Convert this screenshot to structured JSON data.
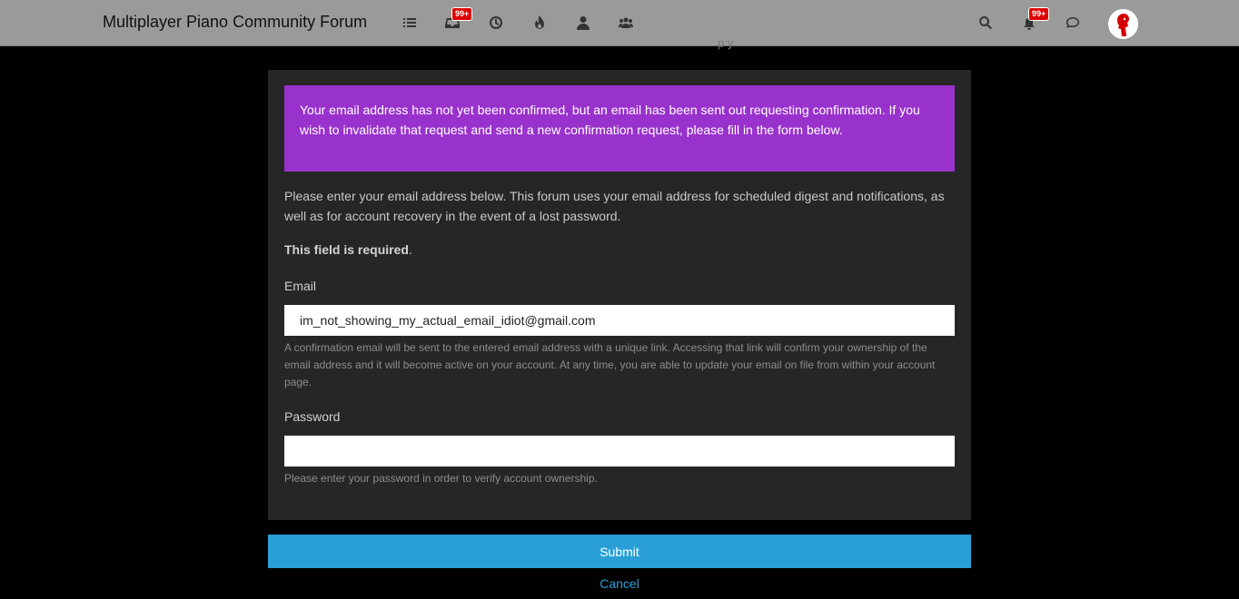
{
  "header": {
    "brand": "Multiplayer Piano Community Forum",
    "nav_icons": [
      "list-icon",
      "inbox-icon",
      "clock-icon",
      "fire-icon",
      "user-icon",
      "group-icon"
    ],
    "inbox_badge": "99+",
    "notifications_badge": "99+",
    "right_icons": [
      "search-icon",
      "bell-icon",
      "chat-icon"
    ]
  },
  "peek_text": "p    y",
  "alert": {
    "text": "Your email address has not yet been confirmed, but an email has been sent out requesting confirmation. If you wish to invalidate that request and send a new confirmation request, please fill in the form below.",
    "color": "#9932cc"
  },
  "intro": "Please enter your email address below. This forum uses your email address for scheduled digest and notifications, as well as for account recovery in the event of a lost password.",
  "required": {
    "bold": "This field is required",
    "suffix": "."
  },
  "email": {
    "label": "Email",
    "value": "im_not_showing_my_actual_email_idiot@gmail.com",
    "help": "A confirmation email will be sent to the entered email address with a unique link. Accessing that link will confirm your ownership of the email address and it will become active on your account. At any time, you are able to update your email on file from within your account page."
  },
  "password": {
    "label": "Password",
    "value": "",
    "help": "Please enter your password in order to verify account ownership."
  },
  "actions": {
    "submit": "Submit",
    "cancel": "Cancel",
    "accent_color": "#2a9fd6"
  }
}
